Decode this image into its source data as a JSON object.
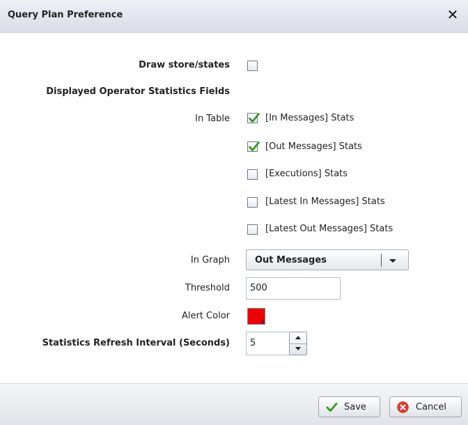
{
  "dialog": {
    "title": "Query Plan Preference",
    "close_symbol": "✕"
  },
  "draw_states": {
    "label": "Draw store/states",
    "checked": false
  },
  "stats_section": {
    "heading": "Displayed Operator Statistics Fields",
    "in_table_label": "In Table",
    "options": [
      {
        "label": "[In Messages] Stats",
        "checked": true
      },
      {
        "label": "[Out Messages] Stats",
        "checked": true
      },
      {
        "label": "[Executions] Stats",
        "checked": false
      },
      {
        "label": "[Latest In Messages] Stats",
        "checked": false
      },
      {
        "label": "[Latest Out Messages] Stats",
        "checked": false
      }
    ]
  },
  "in_graph": {
    "label": "In Graph",
    "selected": "Out Messages",
    "arrow_icon": "triangle-down"
  },
  "threshold": {
    "label": "Threshold",
    "value": "500"
  },
  "alert_color": {
    "label": "Alert Color",
    "color": "#ee0000"
  },
  "refresh_interval": {
    "label": "Statistics Refresh Interval (Seconds)",
    "value": "5"
  },
  "footer": {
    "save_label": "Save",
    "cancel_label": "Cancel",
    "save_icon": "checkmark-green",
    "cancel_icon": "x-circle-red"
  },
  "colors": {
    "titlebar": "#dde1ea",
    "check": "#2f9a1a",
    "cancel_icon": "#e53a2a"
  }
}
